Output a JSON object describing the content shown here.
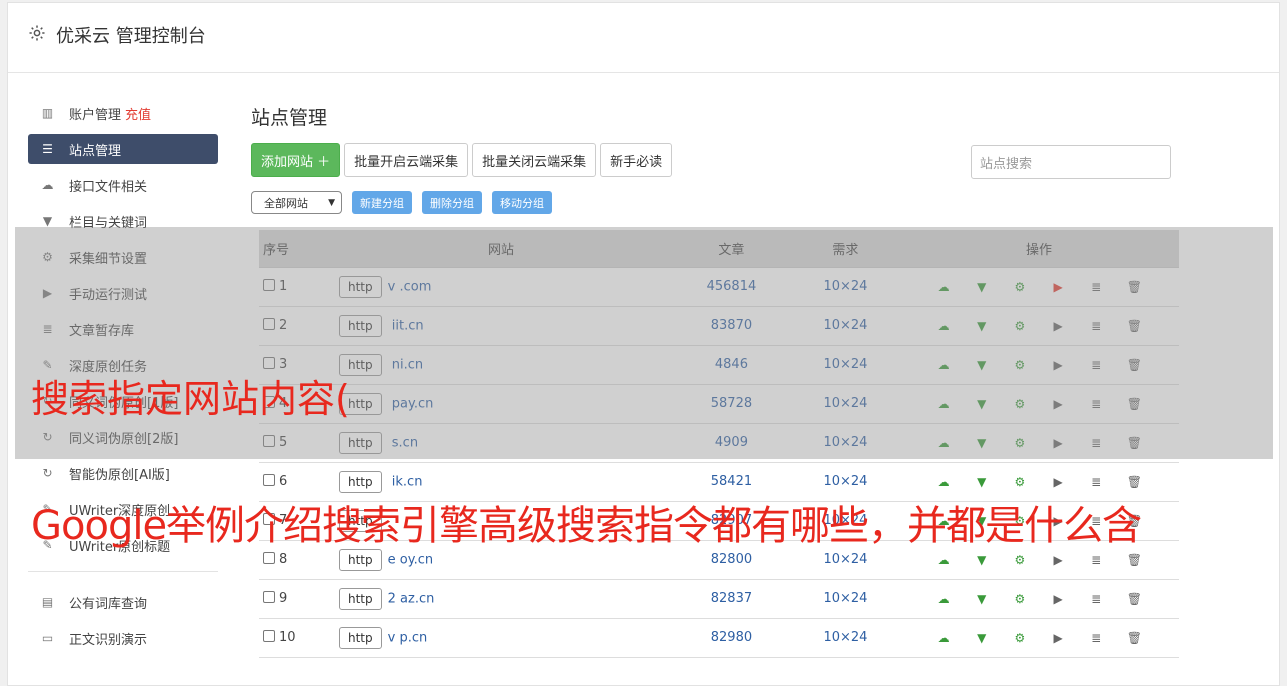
{
  "app": {
    "title": "优采云 管理控制台",
    "icon": "gear-icon"
  },
  "sidebar": {
    "items": [
      {
        "label": "账户管理",
        "badge": "充值",
        "icon": "bar-chart-icon"
      },
      {
        "label": "站点管理",
        "icon": "server-icon",
        "active": true
      },
      {
        "label": "接口文件相关",
        "icon": "cloud-upload-icon"
      },
      {
        "label": "栏目与关键词",
        "icon": "filter-icon"
      },
      {
        "label": "采集细节设置",
        "icon": "cogs-icon"
      },
      {
        "label": "手动运行测试",
        "icon": "play-icon"
      },
      {
        "label": "文章暂存库",
        "icon": "database-icon"
      },
      {
        "label": "深度原创任务",
        "icon": "edit-icon"
      },
      {
        "label": "同义词伪原创[1版]",
        "icon": "refresh-icon"
      },
      {
        "label": "同义词伪原创[2版]",
        "icon": "refresh-icon"
      },
      {
        "label": "智能伪原创[AI版]",
        "icon": "refresh-icon"
      },
      {
        "label": "UWriter深度原创",
        "icon": "edit-icon"
      },
      {
        "label": "UWriter原创标题",
        "icon": "edit-icon"
      }
    ],
    "extra": [
      {
        "label": "公有词库查询",
        "icon": "book-icon"
      },
      {
        "label": "正文识别演示",
        "icon": "monitor-icon"
      }
    ]
  },
  "main": {
    "title": "站点管理",
    "toolbar": {
      "add": "添加网站 ＋",
      "batch_open": "批量开启云端采集",
      "batch_close": "批量关闭云端采集",
      "guide": "新手必读"
    },
    "search_placeholder": "站点搜索",
    "group_select": "全部网站",
    "group_buttons": {
      "new": "新建分组",
      "delete": "删除分组",
      "move": "移动分组"
    },
    "columns": {
      "no": "序号",
      "site": "网站",
      "articles": "文章",
      "demand": "需求",
      "ops": "操作"
    },
    "rows": [
      {
        "no": "1",
        "http": "http",
        "domain": "v          .com",
        "articles": "456814",
        "demand": "10×24"
      },
      {
        "no": "2",
        "http": "http",
        "domain": "     iit.cn",
        "articles": "83870",
        "demand": "10×24"
      },
      {
        "no": "3",
        "http": "http",
        "domain": "      ni.cn",
        "articles": "4846",
        "demand": "10×24"
      },
      {
        "no": "4",
        "http": "http",
        "domain": "      pay.cn",
        "articles": "58728",
        "demand": "10×24"
      },
      {
        "no": "5",
        "http": "http",
        "domain": "      s.cn",
        "articles": "4909",
        "demand": "10×24"
      },
      {
        "no": "6",
        "http": "http",
        "domain": "      ik.cn",
        "articles": "58421",
        "demand": "10×24"
      },
      {
        "no": "7",
        "http": "http",
        "domain": "",
        "articles": "82907",
        "demand": "10×24"
      },
      {
        "no": "8",
        "http": "http",
        "domain": "e     oy.cn",
        "articles": "82800",
        "demand": "10×24"
      },
      {
        "no": "9",
        "http": "http",
        "domain": "2     az.cn",
        "articles": "82837",
        "demand": "10×24"
      },
      {
        "no": "10",
        "http": "http",
        "domain": "v     p.cn",
        "articles": "82980",
        "demand": "10×24"
      }
    ]
  },
  "overlay": {
    "line1": "搜索指定网站内容(",
    "line2": "Google举例介绍搜索引擎高级搜索指令都有哪些，并都是什么含"
  },
  "colors": {
    "accent_green": "#5cb85c",
    "sidebar_active": "#3e4d6a",
    "link_blue": "#2e5fa3",
    "overlay_red": "#e8281e"
  }
}
